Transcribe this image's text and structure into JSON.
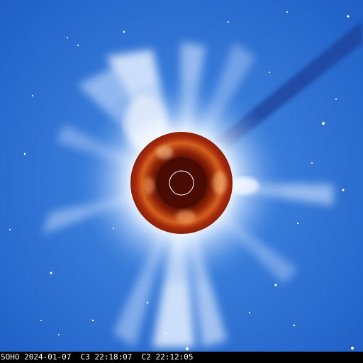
{
  "image": {
    "subject": "SOHO LASCO composite coronagraph",
    "background_color": "#2f72d6",
    "occulter_color": "#a52a0e",
    "inner_disk_color": "#5a0f04",
    "corona_color": "#ffffff",
    "sun_outline_color": "#ffffff"
  },
  "caption": {
    "text": "SOHO 2024-01-07  C3 22:18:07  C2 22:12:05"
  }
}
